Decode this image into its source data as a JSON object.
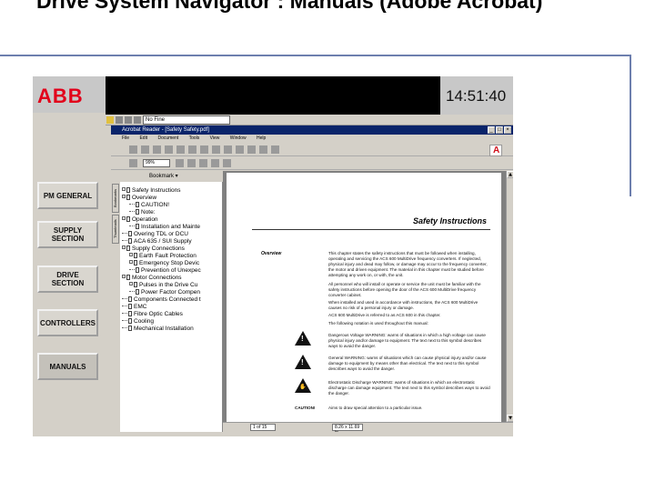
{
  "slide": {
    "title": "Drive System Navigator : Manuals (Adobe Acrobat)"
  },
  "hmi": {
    "logo": "ABB",
    "clock": "14:51:40",
    "nav_buttons": [
      {
        "label": "PM GENERAL"
      },
      {
        "label": "SUPPLY\nSECTION"
      },
      {
        "label": "DRIVE\nSECTION"
      },
      {
        "label": "CONTROLLERS"
      },
      {
        "label": "MANUALS"
      }
    ],
    "url_value": "No Fine"
  },
  "acrobat": {
    "window_title": "Acrobat Reader - [Safety Safety.pdf]",
    "menu": [
      "File",
      "Edit",
      "Document",
      "Tools",
      "View",
      "Window",
      "Help"
    ],
    "zoom": "99%",
    "bookmark_header": "Bookmark",
    "side_tabs": [
      "Bookmarks",
      "Thumbnails"
    ],
    "bookmarks": [
      {
        "indent": 0,
        "toggle": "-",
        "text": "Safety Instructions"
      },
      {
        "indent": 0,
        "toggle": "-",
        "text": "Overview"
      },
      {
        "indent": 1,
        "toggle": "",
        "text": "CAUTION!"
      },
      {
        "indent": 1,
        "toggle": "",
        "text": "Note:"
      },
      {
        "indent": 0,
        "toggle": "-",
        "text": "Operation"
      },
      {
        "indent": 1,
        "toggle": "",
        "text": "Installation and Mainte"
      },
      {
        "indent": 0,
        "toggle": "",
        "text": "Overing TDL or DCU"
      },
      {
        "indent": 0,
        "toggle": "",
        "text": "ACA 635 / SUI Supply"
      },
      {
        "indent": 0,
        "toggle": "-",
        "text": "Supply Connections"
      },
      {
        "indent": 1,
        "toggle": "+",
        "text": "Earth Fault Protection"
      },
      {
        "indent": 1,
        "toggle": "+",
        "text": "Emergency Stop Devic"
      },
      {
        "indent": 1,
        "toggle": "",
        "text": "Prevention of Unexpec"
      },
      {
        "indent": 0,
        "toggle": "-",
        "text": "Motor Connections"
      },
      {
        "indent": 1,
        "toggle": "+",
        "text": "Pulses in the Drive Cu"
      },
      {
        "indent": 1,
        "toggle": "",
        "text": "Power Factor Compen"
      },
      {
        "indent": 0,
        "toggle": "",
        "text": "Components Connected t"
      },
      {
        "indent": 0,
        "toggle": "",
        "text": "EMC"
      },
      {
        "indent": 0,
        "toggle": "",
        "text": "Fibre Optic Cables"
      },
      {
        "indent": 0,
        "toggle": "",
        "text": "Cooling"
      },
      {
        "indent": 0,
        "toggle": "",
        "text": "Mechanical Installation"
      }
    ],
    "page": {
      "heading": "Safety Instructions",
      "section_label": "Overview",
      "paragraphs": [
        "This chapter states the safety instructions that must be followed when installing, operating and servicing the ACS 600 MultiDrive frequency converters. If neglected, physical injury and dead may follow, or damage may occur to the frequency converter, the motor and driven equipment. The material in this chapter must be studied before attempting any work on, or with, the unit.",
        "All personnel who will install or operate or service the unit must be familiar with the safety instructions before opening the door of the ACS 600 MultiDrive frequency converter cabinet.",
        "When installed and used in accordance with instructions, the ACS 600 MultiDrive causes no risk of a personal injury or damage.",
        "ACS 600 MultiDrive is referred to as ACS 600 in this chapter.",
        "The following notation is used throughout this manual:",
        "Dangerous Voltage WARNING: warns of situations in which a high voltage can cause physical injury and/or damage to equipment. The text next to this symbol describes ways to avoid the danger.",
        "General WARNING: warns of situations which can cause physical injury and/or cause damage to equipment by means other than electrical. The text next to this symbol describes ways to avoid the danger.",
        "Electrostatic Discharge WARNING: warns of situations in which an electrostatic discharge can damage equipment. The text next to this symbol describes ways to avoid the danger."
      ],
      "caution_label": "CAUTION!",
      "caution_text": "Aims to draw special attention to a particular issue."
    },
    "status_page": "1 of 15",
    "status_size": "8.26 x 11.69 in"
  }
}
